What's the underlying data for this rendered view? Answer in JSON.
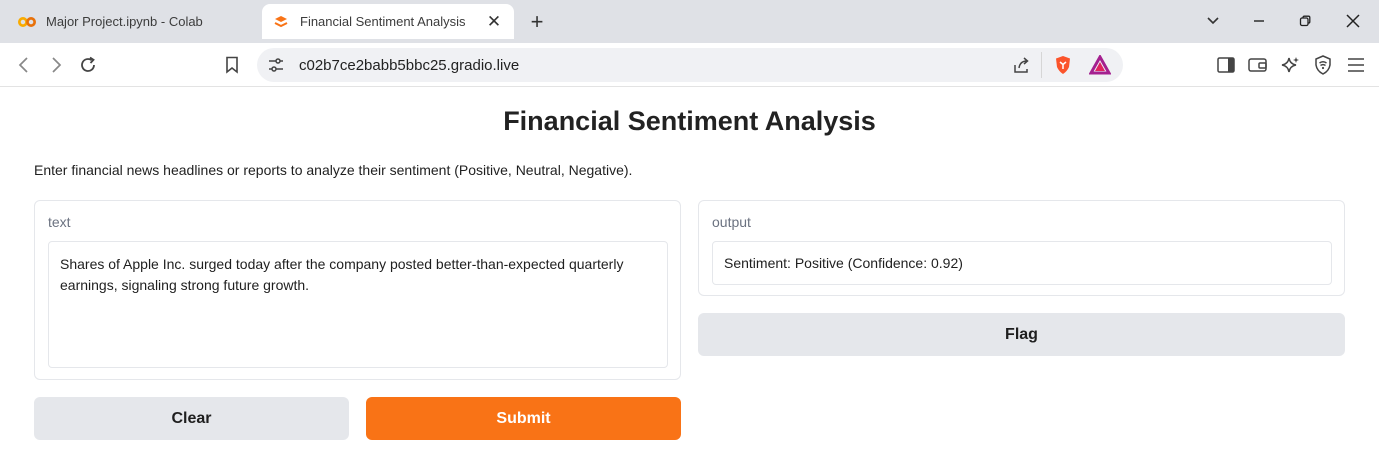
{
  "browser": {
    "tabs": [
      {
        "title": "Major Project.ipynb - Colab",
        "active": false,
        "icon": "colab-icon"
      },
      {
        "title": "Financial Sentiment Analysis",
        "active": true,
        "icon": "gradio-icon"
      }
    ],
    "url": "c02b7ce2babb5bbc25.gradio.live"
  },
  "app": {
    "title": "Financial Sentiment Analysis",
    "description": "Enter financial news headlines or reports to analyze their sentiment (Positive, Neutral, Negative).",
    "input": {
      "label": "text",
      "value": "Shares of Apple Inc. surged today after the company posted better-than-expected quarterly earnings, signaling strong future growth."
    },
    "output": {
      "label": "output",
      "value": "Sentiment: Positive (Confidence: 0.92)"
    },
    "buttons": {
      "clear": "Clear",
      "submit": "Submit",
      "flag": "Flag"
    }
  },
  "colors": {
    "accent": "#f97316",
    "secondary_button": "#e5e7eb"
  }
}
